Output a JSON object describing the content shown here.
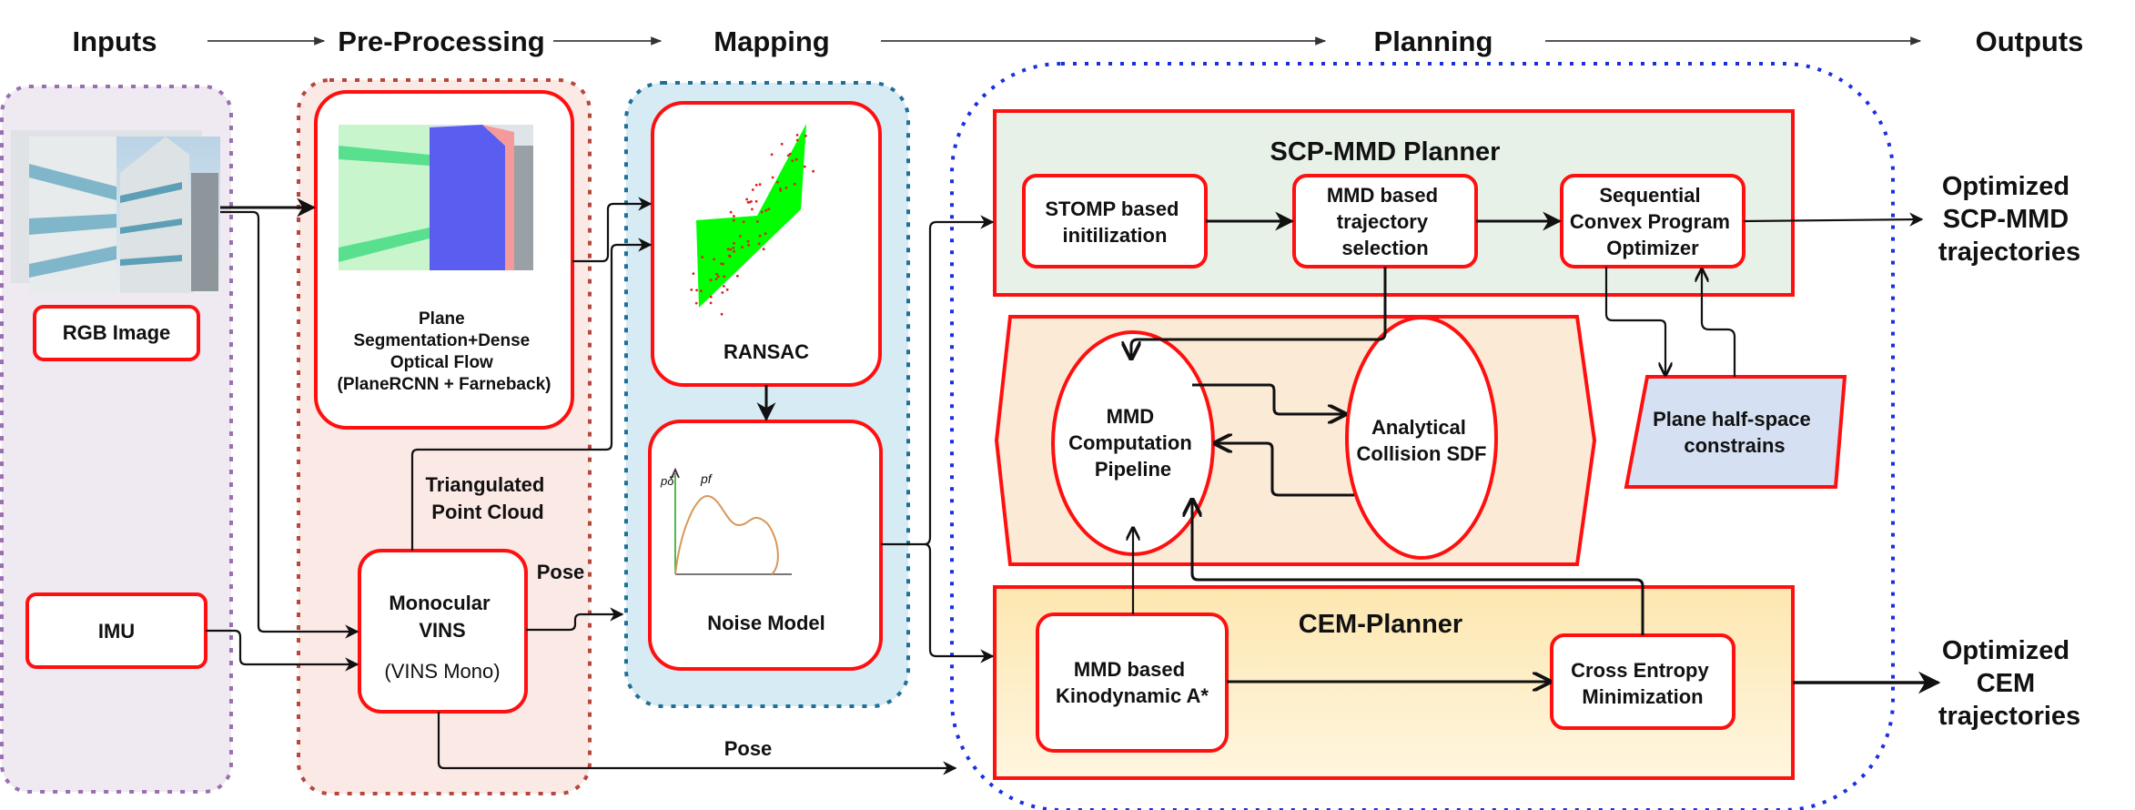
{
  "stages": {
    "inputs": "Inputs",
    "preprocessing": "Pre-Processing",
    "mapping": "Mapping",
    "planning": "Planning",
    "outputs": "Outputs"
  },
  "inputs": {
    "rgb_image": "RGB Image",
    "imu": "IMU"
  },
  "preprocessing": {
    "plane_seg": [
      "Plane",
      "Segmentation+Dense",
      "Optical Flow",
      "(PlaneRCNN + Farneback)"
    ],
    "triangulated": [
      "Triangulated",
      "Point Cloud"
    ],
    "vins": [
      "Monocular",
      "VINS"
    ],
    "vins_sub": "(VINS Mono)",
    "pose_label_1": "Pose",
    "pose_label_2": "Pose"
  },
  "mapping": {
    "ransac": "RANSAC",
    "noise_model": "Noise Model",
    "noise_axis_y": "pδ",
    "noise_curve_label": "pf"
  },
  "planning": {
    "scp_title": "SCP-MMD Planner",
    "stomp": [
      "STOMP based",
      "initilization"
    ],
    "mmd_selection": [
      "MMD based",
      "trajectory",
      "selection"
    ],
    "scp_optimizer": [
      "Sequential",
      "Convex Program",
      "Optimizer"
    ],
    "mmd_pipeline": [
      "MMD",
      "Computation",
      "Pipeline"
    ],
    "collision_sdf": [
      "Analytical",
      "Collision SDF"
    ],
    "plane_constraints": [
      "Plane half-space",
      "constrains"
    ],
    "cem_title": "CEM-Planner",
    "kinodynamic": [
      "MMD based",
      "Kinodynamic A*"
    ],
    "cross_entropy": [
      "Cross Entropy",
      "Minimization"
    ]
  },
  "outputs": {
    "scp": [
      "Optimized",
      "SCP-MMD",
      "trajectories"
    ],
    "cem": [
      "Optimized",
      "CEM",
      "trajectories"
    ]
  },
  "colors": {
    "node_border": "#ff1010",
    "inputs_group_fill": "#efe9f2",
    "inputs_group_border": "#9a6fb0",
    "pre_group_fill": "#fbe9e6",
    "pre_group_border": "#b5473c",
    "mapping_group_fill": "#d6ebf4",
    "mapping_group_border": "#1f6f94",
    "planning_group_border": "#1a2fe0",
    "scp_fill": "#e8f1e8",
    "middle_fill": "#fbead6",
    "cem_fill": "#fde9b8",
    "plane_constraints_fill": "#d5e0f2",
    "ransac_plane": "#00ff00",
    "ransac_points": "#e02020",
    "noise_curve": "#d8975a"
  }
}
